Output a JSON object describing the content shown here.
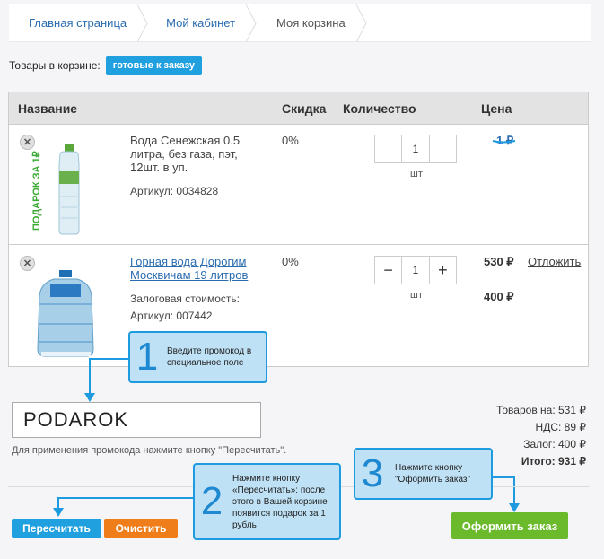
{
  "breadcrumb": {
    "home": "Главная страница",
    "cabinet": "Мой кабинет",
    "current": "Моя корзина"
  },
  "status": {
    "label": "Товары в корзине:",
    "badge": "готовые к заказу"
  },
  "table": {
    "headers": {
      "name": "Название",
      "discount": "Скидка",
      "quantity": "Количество",
      "price": "Цена"
    },
    "rows": [
      {
        "remove": "✕",
        "gift_label": "ПОДАРОК ЗА 1₽",
        "name": "Вода Сенежская 0.5 литра, без газа, пэт, 12шт. в уп.",
        "article": "Артикул: 0034828",
        "discount": "0%",
        "qty": "1",
        "unit": "шт",
        "price": "1 ₽"
      },
      {
        "remove": "✕",
        "name": "Горная вода Дорогим Москвичам 19 литров",
        "deposit": "Залоговая стоимость:",
        "article": "Артикул: 007442",
        "discount": "0%",
        "qty_minus": "−",
        "qty": "1",
        "qty_plus": "+",
        "unit": "шт",
        "price": "530 ₽",
        "deposit_price": "400 ₽",
        "defer": "Отложить"
      }
    ]
  },
  "promo": {
    "value": "PODAROK",
    "hint": "Для применения промокода нажмите кнопку \"Пересчитать\"."
  },
  "totals": {
    "goods_label": "Товаров на:",
    "goods": "531 ₽",
    "vat_label": "НДС:",
    "vat": "89 ₽",
    "deposit_label": "Залог:",
    "deposit": "400 ₽",
    "total_label": "Итого:",
    "total": "931 ₽"
  },
  "buttons": {
    "recalc": "Пересчитать",
    "clear": "Очистить",
    "order": "Оформить заказ"
  },
  "callouts": [
    {
      "num": "1",
      "text": "Введите промокод в специальное поле"
    },
    {
      "num": "2",
      "text": "Нажмите кнопку «Пересчитать»: после этого в Вашей корзине появится подарок за 1 рубль"
    },
    {
      "num": "3",
      "text": "Нажмите кнопку \"Оформить заказ\""
    }
  ],
  "colors": {
    "accent": "#21a0e0",
    "clear": "#ef7d1a",
    "order": "#6aba2b",
    "callout_bg": "#bfe1f5",
    "gift_green": "#3aaa35"
  }
}
